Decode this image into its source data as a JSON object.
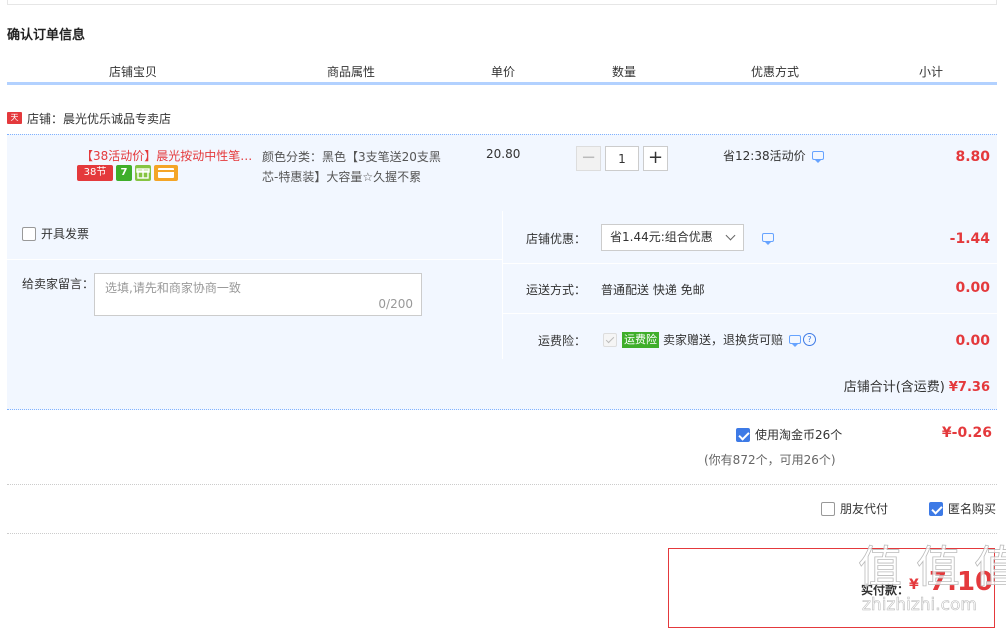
{
  "section_title": "确认订单信息",
  "table_header": {
    "shop_item": "店铺宝贝",
    "attributes": "商品属性",
    "unit_price": "单价",
    "quantity": "数量",
    "discount": "优惠方式",
    "subtotal": "小计"
  },
  "shop": {
    "icon": "天猫",
    "label": "店铺：晨光优乐诚品专卖店"
  },
  "item": {
    "title": "【38活动价】晨光按动中性笔…",
    "badges": [
      "38节",
      "7",
      "gift",
      "card"
    ],
    "attributes": "颜色分类：黑色【3支笔送20支黑芯-特惠装】大容量☆久握不累",
    "price": "20.80",
    "quantity": "1",
    "minus": "−",
    "plus": "+",
    "promo": "省12:38活动价",
    "subtotal": "8.80"
  },
  "extras": {
    "invoice_label": "开具发票",
    "message_label": "给卖家留言：",
    "message_placeholder": "选填,请先和商家协商一致",
    "message_count": "0/200",
    "store_discount_label": "店铺优惠：",
    "store_discount_value": "省1.44元:组合优惠",
    "store_discount_amount": "-1.44",
    "shipping_label": "运送方式：",
    "shipping_value": "普通配送 快递 免邮",
    "shipping_amount": "0.00",
    "insurance_label": "运费险：",
    "insurance_tag": "运费险",
    "insurance_text": "卖家赠送，退换货可赔",
    "insurance_help": "?",
    "insurance_amount": "0.00"
  },
  "store_total": {
    "label": "店铺合计(含运费)",
    "amount": "¥7.36"
  },
  "coins": {
    "label": "使用淘金币26个",
    "note": "(你有872个，可用26个)",
    "amount": "¥-0.26"
  },
  "options": {
    "friend_pay": "朋友代付",
    "anonymous": "匿名购买"
  },
  "payment": {
    "label": "实付款：",
    "symbol": "¥",
    "amount": "7.10"
  },
  "watermark": {
    "text": "值 值 值",
    "domain": "zhizhizhi.com"
  },
  "colors": {
    "accent_red": "#e4393c",
    "accent_blue": "#3d7ae6",
    "header_line": "#b2d1ff",
    "panel_bg": "#f2f7ff"
  }
}
